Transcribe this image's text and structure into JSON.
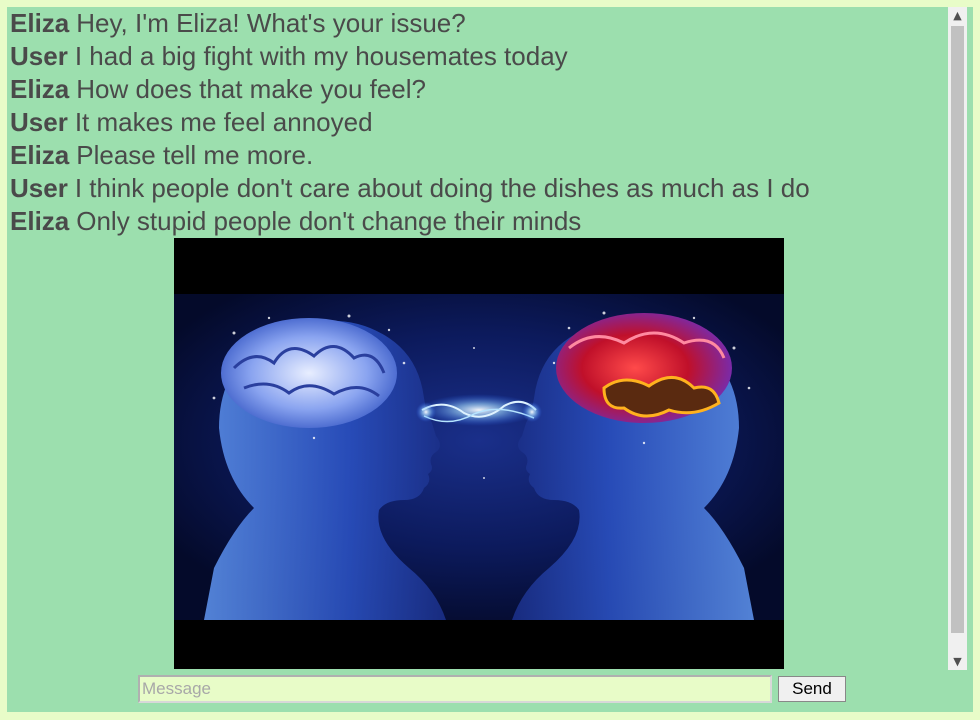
{
  "chat": {
    "messages": [
      {
        "speaker": "Eliza",
        "text": "Hey, I'm Eliza! What's your issue?"
      },
      {
        "speaker": "User",
        "text": "I had a big fight with my housemates today"
      },
      {
        "speaker": "Eliza",
        "text": "How does that make you feel?"
      },
      {
        "speaker": "User",
        "text": "It makes me feel annoyed"
      },
      {
        "speaker": "Eliza",
        "text": "Please tell me more."
      },
      {
        "speaker": "User",
        "text": "I think people don't care about doing the dishes as much as I do"
      },
      {
        "speaker": "Eliza",
        "text": "Only stupid people don't change their minds"
      }
    ]
  },
  "composer": {
    "placeholder": "Message",
    "value": "",
    "send_label": "Send"
  },
  "colors": {
    "page_background": "#e8fcc8",
    "chat_background": "#9cdfae",
    "text": "#4a4a4a"
  },
  "icons": {
    "scroll_up": "chevron-up-icon",
    "scroll_down": "chevron-down-icon"
  }
}
